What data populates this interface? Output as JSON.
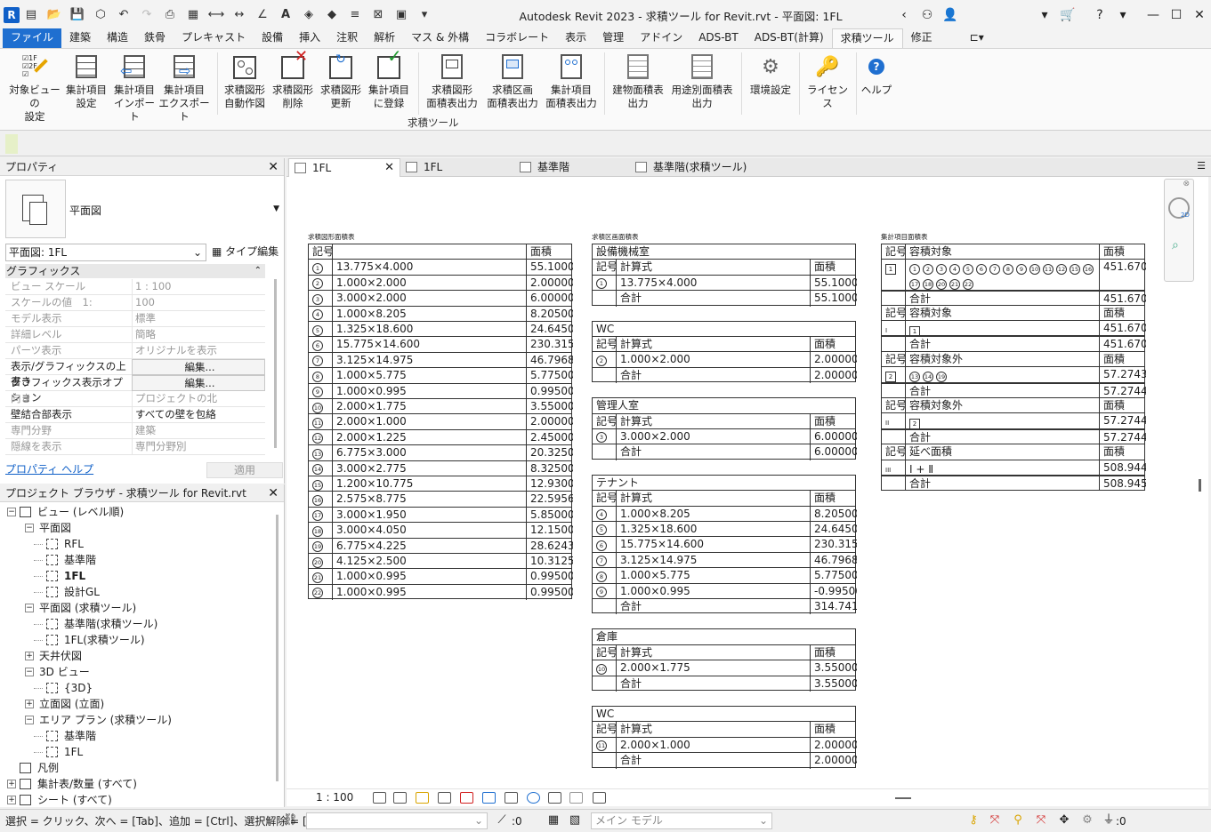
{
  "window": {
    "title": "Autodesk Revit 2023 - 求積ツール for Revit.rvt - 平面図: 1FL",
    "logo": "R"
  },
  "ribbon_tabs": [
    "ファイル",
    "建築",
    "構造",
    "鉄骨",
    "プレキャスト",
    "設備",
    "挿入",
    "注釈",
    "解析",
    "マス & 外構",
    "コラボレート",
    "表示",
    "管理",
    "アドイン",
    "ADS-BT",
    "ADS-BT(計算)",
    "求積ツール",
    "修正"
  ],
  "active_tab": "求積ツール",
  "ribbon": {
    "panel_label": "求積ツール",
    "buttons": [
      {
        "l1": "対象ビューの",
        "l2": "設定"
      },
      {
        "l1": "集計項目",
        "l2": "設定"
      },
      {
        "l1": "集計項目",
        "l2": "インポート"
      },
      {
        "l1": "集計項目",
        "l2": "エクスポート"
      },
      {
        "l1": "求積図形",
        "l2": "自動作図"
      },
      {
        "l1": "求積図形",
        "l2": "削除"
      },
      {
        "l1": "求積図形",
        "l2": "更新"
      },
      {
        "l1": "集計項目",
        "l2": "に登録"
      },
      {
        "l1": "求積図形",
        "l2": "面積表出力"
      },
      {
        "l1": "求積区画",
        "l2": "面積表出力"
      },
      {
        "l1": "集計項目",
        "l2": "面積表出力"
      },
      {
        "l1": "建物面積表",
        "l2": "出力"
      },
      {
        "l1": "用途別面積表",
        "l2": "出力"
      },
      {
        "l1": "環境設定",
        "l2": ""
      },
      {
        "l1": "ライセンス",
        "l2": ""
      },
      {
        "l1": "ヘルプ",
        "l2": ""
      }
    ],
    "icon_labels": {
      "level_1f": "1F",
      "level_2f": "2F"
    }
  },
  "properties": {
    "title": "プロパティ",
    "type_name": "平面図",
    "instance_filter": "平面図: 1FL",
    "edit_type": "タイプ編集",
    "section": "グラフィックス",
    "rows": [
      {
        "k": "ビュー スケール",
        "v": "1 : 100",
        "dark": false
      },
      {
        "k": "スケールの値　1:",
        "v": "100",
        "dark": false
      },
      {
        "k": "モデル表示",
        "v": "標準",
        "dark": false
      },
      {
        "k": "詳細レベル",
        "v": "簡略",
        "dark": false
      },
      {
        "k": "パーツ表示",
        "v": "オリジナルを表示",
        "dark": false
      },
      {
        "k": "表示/グラフィックスの上書き",
        "v": "編集...",
        "dark": true,
        "btn": true
      },
      {
        "k": "グラフィックス表示オプション",
        "v": "編集...",
        "dark": true,
        "btn": true
      },
      {
        "k": "向き",
        "v": "プロジェクトの北",
        "dark": false
      },
      {
        "k": "壁結合部表示",
        "v": "すべての壁を包絡",
        "dark": true
      },
      {
        "k": "専門分野",
        "v": "建築",
        "dark": false
      },
      {
        "k": "隠線を表示",
        "v": "専門分野別",
        "dark": false
      }
    ],
    "help_link": "プロパティ ヘルプ",
    "apply": "適用"
  },
  "browser": {
    "title": "プロジェクト ブラウザ - 求積ツール for Revit.rvt",
    "nodes": [
      {
        "text": "ビュー (レベル順)",
        "toggle": "−",
        "indent": 0,
        "icon": true
      },
      {
        "text": "平面図",
        "toggle": "−",
        "indent": 1,
        "icon": false
      },
      {
        "text": "RFL",
        "toggle": "",
        "indent": 2,
        "icon": true
      },
      {
        "text": "基準階",
        "toggle": "",
        "indent": 2,
        "icon": true
      },
      {
        "text": "1FL",
        "toggle": "",
        "indent": 2,
        "icon": true,
        "bold": true
      },
      {
        "text": "設計GL",
        "toggle": "",
        "indent": 2,
        "icon": true
      },
      {
        "text": "平面図 (求積ツール)",
        "toggle": "−",
        "indent": 1,
        "icon": false
      },
      {
        "text": "基準階(求積ツール)",
        "toggle": "",
        "indent": 2,
        "icon": true
      },
      {
        "text": "1FL(求積ツール)",
        "toggle": "",
        "indent": 2,
        "icon": true
      },
      {
        "text": "天井伏図",
        "toggle": "+",
        "indent": 1,
        "icon": false
      },
      {
        "text": "3D ビュー",
        "toggle": "−",
        "indent": 1,
        "icon": false
      },
      {
        "text": "{3D}",
        "toggle": "",
        "indent": 2,
        "icon": true
      },
      {
        "text": "立面図 (立面)",
        "toggle": "+",
        "indent": 1,
        "icon": false
      },
      {
        "text": "エリア プラン (求積ツール)",
        "toggle": "−",
        "indent": 1,
        "icon": false
      },
      {
        "text": "基準階",
        "toggle": "",
        "indent": 2,
        "icon": true
      },
      {
        "text": "1FL",
        "toggle": "",
        "indent": 2,
        "icon": true
      },
      {
        "text": "凡例",
        "toggle": "",
        "indent": 0,
        "icon": true
      },
      {
        "text": "集計表/数量 (すべて)",
        "toggle": "+",
        "indent": 0,
        "icon": true
      },
      {
        "text": "シート (すべて)",
        "toggle": "+",
        "indent": 0,
        "icon": true
      }
    ]
  },
  "view_tabs": [
    {
      "label": "1FL",
      "active": true
    },
    {
      "label": "1FL",
      "active": false
    },
    {
      "label": "基準階",
      "active": false
    },
    {
      "label": "基準階(求積ツール)",
      "active": false
    }
  ],
  "sched1": {
    "title": "求積図形面積表",
    "h_id": "記号",
    "h_area": "面積",
    "rows": [
      [
        "1",
        "13.775×4.000",
        "55.100000"
      ],
      [
        "2",
        "1.000×2.000",
        "2.000000"
      ],
      [
        "3",
        "3.000×2.000",
        "6.000000"
      ],
      [
        "4",
        "1.000×8.205",
        "8.205000"
      ],
      [
        "5",
        "1.325×18.600",
        "24.645000"
      ],
      [
        "6",
        "15.775×14.600",
        "230.315000"
      ],
      [
        "7",
        "3.125×14.975",
        "46.796875"
      ],
      [
        "8",
        "1.000×5.775",
        "5.775000"
      ],
      [
        "9",
        "1.000×0.995",
        "0.995000"
      ],
      [
        "10",
        "2.000×1.775",
        "3.550000"
      ],
      [
        "11",
        "2.000×1.000",
        "2.000000"
      ],
      [
        "12",
        "2.000×1.225",
        "2.450000"
      ],
      [
        "13",
        "6.775×3.000",
        "20.325000"
      ],
      [
        "14",
        "3.000×2.775",
        "8.325000"
      ],
      [
        "15",
        "1.200×10.775",
        "12.930000"
      ],
      [
        "16",
        "2.575×8.775",
        "22.595625"
      ],
      [
        "17",
        "3.000×1.950",
        "5.850000"
      ],
      [
        "18",
        "3.000×4.050",
        "12.150000"
      ],
      [
        "19",
        "6.775×4.225",
        "28.624375"
      ],
      [
        "20",
        "4.125×2.500",
        "10.312500"
      ],
      [
        "21",
        "1.000×0.995",
        "0.995000"
      ],
      [
        "22",
        "1.000×0.995",
        "0.995000"
      ]
    ]
  },
  "sched2": {
    "title": "求積区画面積表",
    "h_id": "記号",
    "h_formula": "計算式",
    "h_area": "面積",
    "total": "合計",
    "groups": [
      {
        "name": "設備機械室",
        "rows": [
          [
            "1",
            "13.775×4.000",
            "55.100000"
          ]
        ],
        "total": "55.100000"
      },
      {
        "name": "WC",
        "rows": [
          [
            "2",
            "1.000×2.000",
            "2.000000"
          ]
        ],
        "total": "2.000000"
      },
      {
        "name": "管理人室",
        "rows": [
          [
            "3",
            "3.000×2.000",
            "6.000000"
          ]
        ],
        "total": "6.000000"
      },
      {
        "name": "テナント",
        "rows": [
          [
            "4",
            "1.000×8.205",
            "8.205000"
          ],
          [
            "5",
            "1.325×18.600",
            "24.645000"
          ],
          [
            "6",
            "15.775×14.600",
            "230.315000"
          ],
          [
            "7",
            "3.125×14.975",
            "46.796875"
          ],
          [
            "8",
            "1.000×5.775",
            "5.775000"
          ],
          [
            "9",
            "1.000×0.995",
            "-0.995000"
          ]
        ],
        "total": "314.741875"
      },
      {
        "name": "倉庫",
        "rows": [
          [
            "10",
            "2.000×1.775",
            "3.550000"
          ]
        ],
        "total": "3.550000"
      },
      {
        "name": "WC",
        "rows": [
          [
            "11",
            "2.000×1.000",
            "2.000000"
          ]
        ],
        "total": "2.000000"
      }
    ]
  },
  "sched3": {
    "title": "集計項目面積表",
    "blocks": [
      {
        "h1": "記号",
        "h2": "容積対象",
        "h3": "面積",
        "id": "1",
        "id_box": true,
        "ids": [
          "1",
          "2",
          "3",
          "4",
          "5",
          "6",
          "7",
          "8",
          "9",
          "10",
          "11",
          "12",
          "15",
          "16",
          "17",
          "18",
          "20",
          "21",
          "22"
        ],
        "value": "451.670000",
        "total_label": "合計",
        "total": "451.6700"
      },
      {
        "h1": "記号",
        "h2": "容積対象",
        "h3": "面積",
        "id": "I",
        "id_box": false,
        "boxed": "1",
        "value": "451.6700",
        "total_label": "合計",
        "total": "451.6700"
      },
      {
        "h1": "記号",
        "h2": "容積対象外",
        "h3": "面積",
        "id": "2",
        "id_box": true,
        "ids": [
          "13",
          "14",
          "19"
        ],
        "value": "57.274375",
        "total_label": "合計",
        "total": "57.2744"
      },
      {
        "h1": "記号",
        "h2": "容積対象外",
        "h3": "面積",
        "id": "II",
        "id_box": false,
        "boxed": "2",
        "value": "57.2744",
        "total_label": "合計",
        "total": "57.2744"
      },
      {
        "h1": "記号",
        "h2": "延べ面積",
        "h3": "面積",
        "id": "III",
        "id_box": false,
        "text": "Ⅰ + Ⅱ",
        "value": "508.9444",
        "total_label": "合計",
        "total": "508.945"
      }
    ]
  },
  "view_control": {
    "scale": "1 : 100"
  },
  "status": {
    "hint": "選択 = クリック、次へ = [Tab]、追加 = [Ctrl]、選択解除 = [Shift]",
    "sel_count": ":0",
    "model": "メイン モデル",
    "filter_count": ":0"
  }
}
